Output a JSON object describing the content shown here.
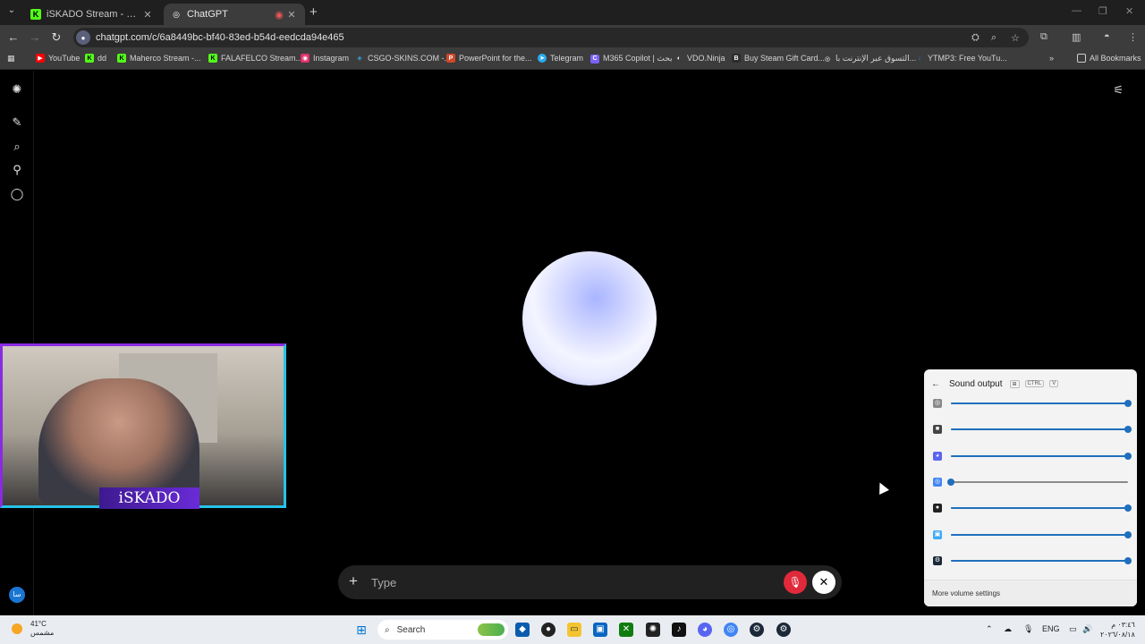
{
  "browser": {
    "tabs": [
      {
        "title": "iSKADO Stream - Watch Live on",
        "favicon": "K"
      },
      {
        "title": "ChatGPT",
        "favicon": "◎"
      }
    ],
    "url": "chatgpt.com/c/6a8449bc-bf40-83ed-b54d-eedcda94e465",
    "bookmarks": [
      {
        "label": "YouTube",
        "icon": "▶",
        "color": "#ff0000"
      },
      {
        "label": "dd",
        "icon": "K",
        "color": "#53fc18"
      },
      {
        "label": "Maherco Stream -...",
        "icon": "K",
        "color": "#53fc18"
      },
      {
        "label": "FALAFELCO Stream...",
        "icon": "K",
        "color": "#53fc18"
      },
      {
        "label": "Instagram",
        "icon": "◉",
        "color": "#e1306c"
      },
      {
        "label": "CSGO-SKINS.COM -...",
        "icon": "◈",
        "color": "#3aa3e3"
      },
      {
        "label": "PowerPoint for the...",
        "icon": "P",
        "color": "#d24726"
      },
      {
        "label": "Telegram",
        "icon": "➤",
        "color": "#2aabee"
      },
      {
        "label": "M365 Copilot | بحث",
        "icon": "C",
        "color": "#7b61ff"
      },
      {
        "label": "VDO.Ninja",
        "icon": "◐",
        "color": "#ffffff"
      },
      {
        "label": "Buy Steam Gift Card...",
        "icon": "B",
        "color": "#2c2c2c"
      },
      {
        "label": "التسوق عبر الإنترنت با...",
        "icon": "◎",
        "color": "#ffffff"
      },
      {
        "label": "YTMP3: Free YouTu...",
        "icon": "↓",
        "color": "#3b82f6"
      }
    ],
    "all_bookmarks": "All Bookmarks"
  },
  "composer": {
    "placeholder": "Type"
  },
  "webcam": {
    "name": "iSKADO"
  },
  "sound_flyout": {
    "title": "Sound output",
    "shortcut_keys": [
      "CTRL",
      "V"
    ],
    "rows": [
      {
        "icon": "system-sounds-icon",
        "color": "#888888",
        "level": 1.0
      },
      {
        "icon": "app-icon",
        "color": "#444444",
        "level": 1.0
      },
      {
        "icon": "discord-icon",
        "color": "#5865f2",
        "level": 1.0
      },
      {
        "icon": "chrome-icon",
        "color": "#4285f4",
        "level": 0.0
      },
      {
        "icon": "obs-icon",
        "color": "#222222",
        "level": 1.0
      },
      {
        "icon": "app-icon-2",
        "color": "#3fa9f5",
        "level": 1.0
      },
      {
        "icon": "steam-icon",
        "color": "#1b2838",
        "level": 1.0
      }
    ],
    "footer": "More volume settings"
  },
  "taskbar": {
    "weather_temp": "41°C",
    "weather_desc": "مشمس",
    "search_label": "Search",
    "language": "ENG",
    "time": "٠٣:٤٦ م",
    "date": "٢٠٢٦/٠٨/١٨"
  },
  "sidebar": {
    "user_initials": "سا"
  }
}
